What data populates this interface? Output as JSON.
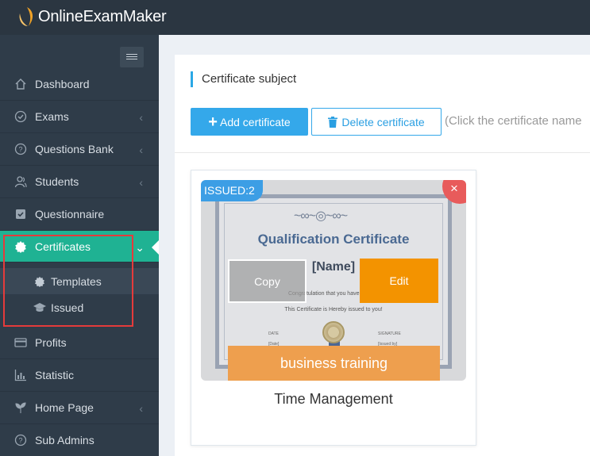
{
  "app": {
    "logo_text": "OnlineExamMaker",
    "logo_color": "#f0a226"
  },
  "sidebar": {
    "items": [
      {
        "label": "Dashboard",
        "icon": "home-icon",
        "chevron": false
      },
      {
        "label": "Exams",
        "icon": "check-circle-icon",
        "chevron": true
      },
      {
        "label": "Questions Bank",
        "icon": "question-circle-icon",
        "chevron": true
      },
      {
        "label": "Students",
        "icon": "users-icon",
        "chevron": true
      },
      {
        "label": "Questionnaire",
        "icon": "checkbox-icon",
        "chevron": false
      },
      {
        "label": "Certificates",
        "icon": "badge-icon",
        "chevron": true,
        "active": true
      },
      {
        "label": "Profits",
        "icon": "card-icon",
        "chevron": false
      },
      {
        "label": "Statistic",
        "icon": "bar-chart-icon",
        "chevron": false
      },
      {
        "label": "Home Page",
        "icon": "leaf-icon",
        "chevron": true
      },
      {
        "label": "Sub Admins",
        "icon": "question-circle-icon",
        "chevron": false
      }
    ],
    "sub_items": [
      {
        "label": "Templates",
        "icon": "badge-icon",
        "selected": true
      },
      {
        "label": "Issued",
        "icon": "graduation-cap-icon",
        "selected": false
      }
    ],
    "active_color": "#1fb293"
  },
  "main": {
    "title": "Certificate subject",
    "add_button": "Add certificate",
    "delete_button": "Delete certificate",
    "hint": "(Click the certificate name"
  },
  "card": {
    "issued_badge": "ISSUED:2",
    "cert_title": "Qualification Certificate",
    "cert_name": "[Name]",
    "cert_line1": "Congratulation that you have passed",
    "cert_line2": "This Certificate is Hereby issued to you!",
    "cert_date_label": "DATE",
    "cert_date": "[Date]",
    "cert_sig_label": "SIGNATURE",
    "cert_sig": "[Issued by]",
    "copy_label": "Copy",
    "edit_label": "Edit",
    "tag": "business training",
    "name": "Time Management",
    "close_symbol": "×"
  }
}
